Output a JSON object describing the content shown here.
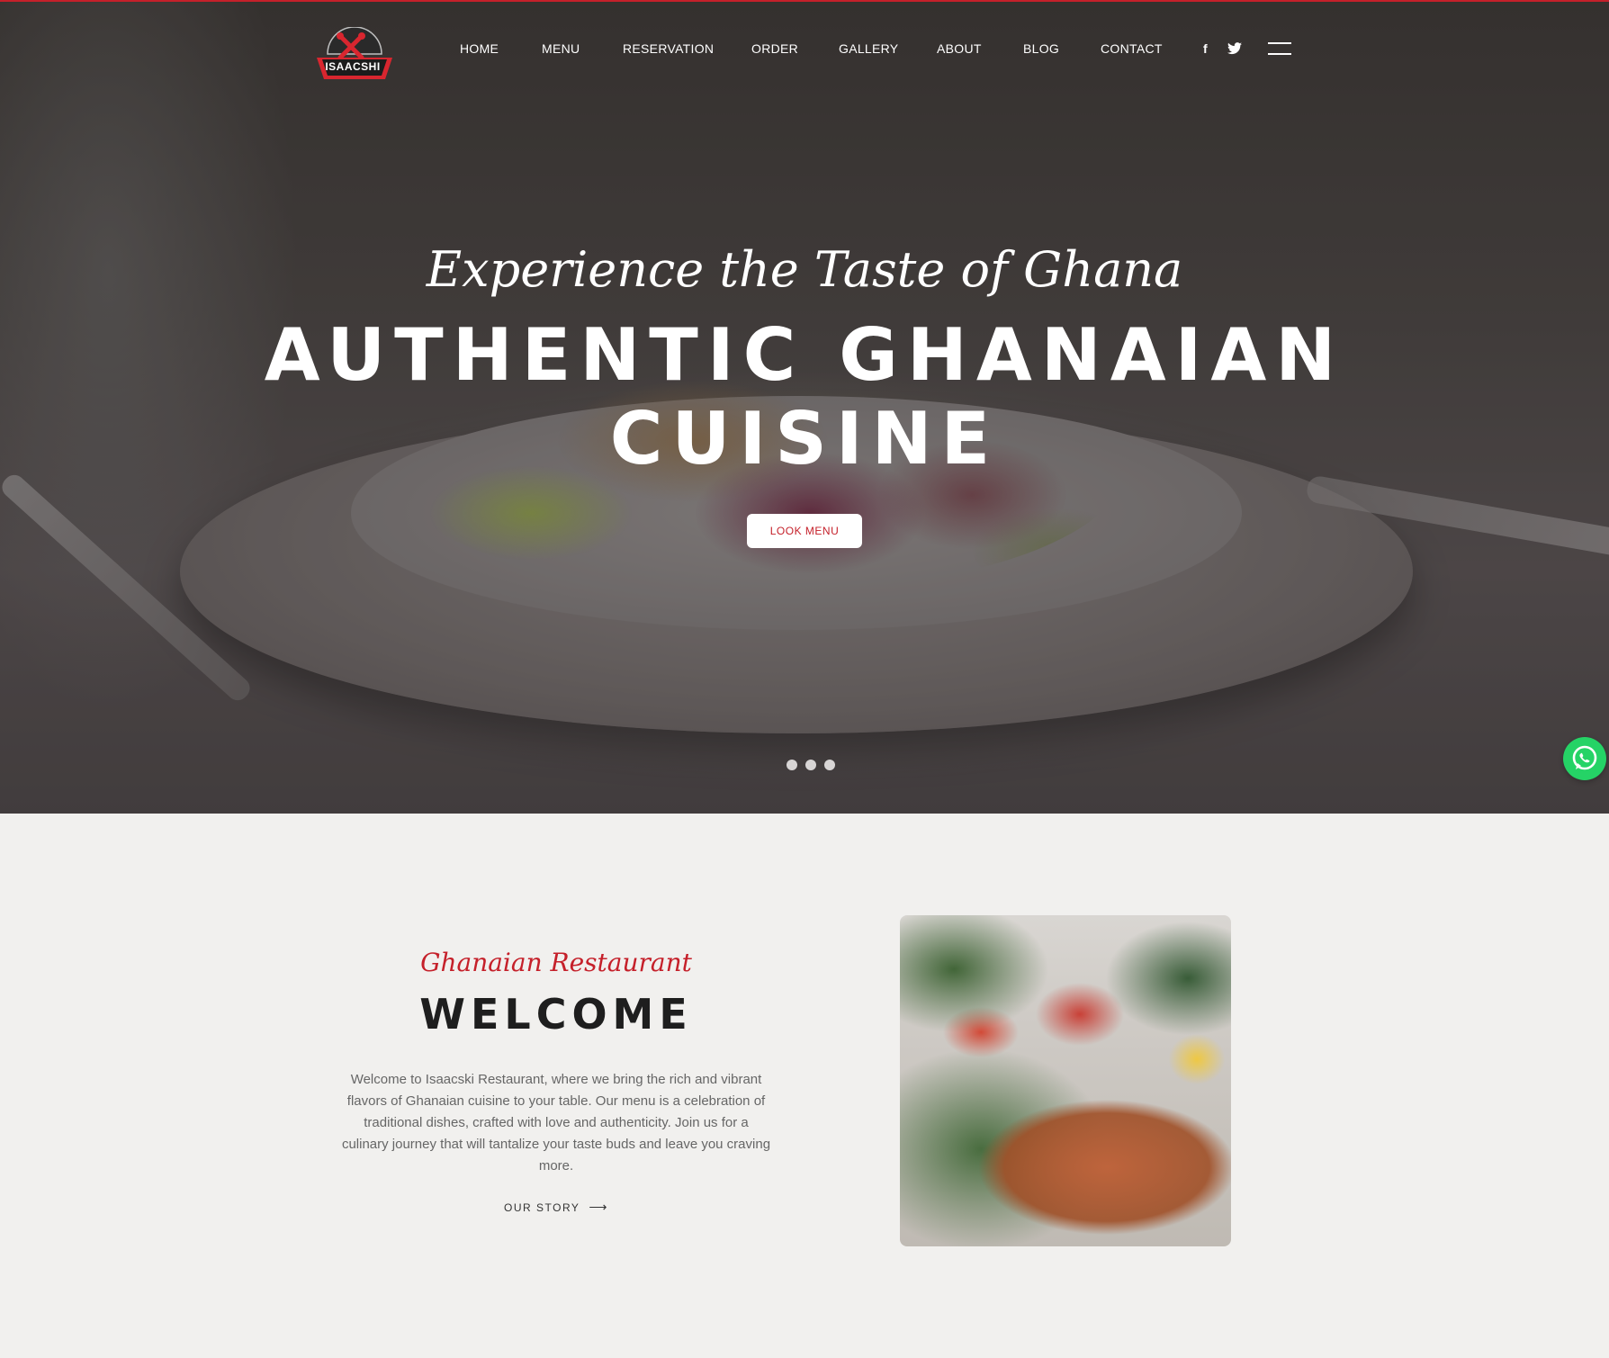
{
  "brand": {
    "logo_text": "ISAACSHI"
  },
  "nav": {
    "items": [
      "HOME",
      "MENU",
      "RESERVATION",
      "ORDER",
      "GALLERY",
      "ABOUT",
      "BLOG",
      "CONTACT"
    ]
  },
  "social": {
    "facebook": "f",
    "twitter": "twitter-icon"
  },
  "hero": {
    "script": "Experience the Taste of Ghana",
    "title_line1": "AUTHENTIC GHANAIAN",
    "title_line2": "CUISINE",
    "cta_label": "LOOK MENU",
    "slide_count": 3
  },
  "welcome": {
    "script": "Ghanaian Restaurant",
    "title": "WELCOME",
    "body": "Welcome to Isaacski Restaurant, where we bring the rich and vibrant flavors of Ghanaian cuisine to your table. Our menu is a celebration of traditional dishes, crafted with love and authenticity. Join us for a culinary journey that will tantalize your taste buds and leave you craving more.",
    "link_label": "OUR STORY"
  },
  "colors": {
    "accent": "#c5202a",
    "whatsapp": "#25d366"
  }
}
